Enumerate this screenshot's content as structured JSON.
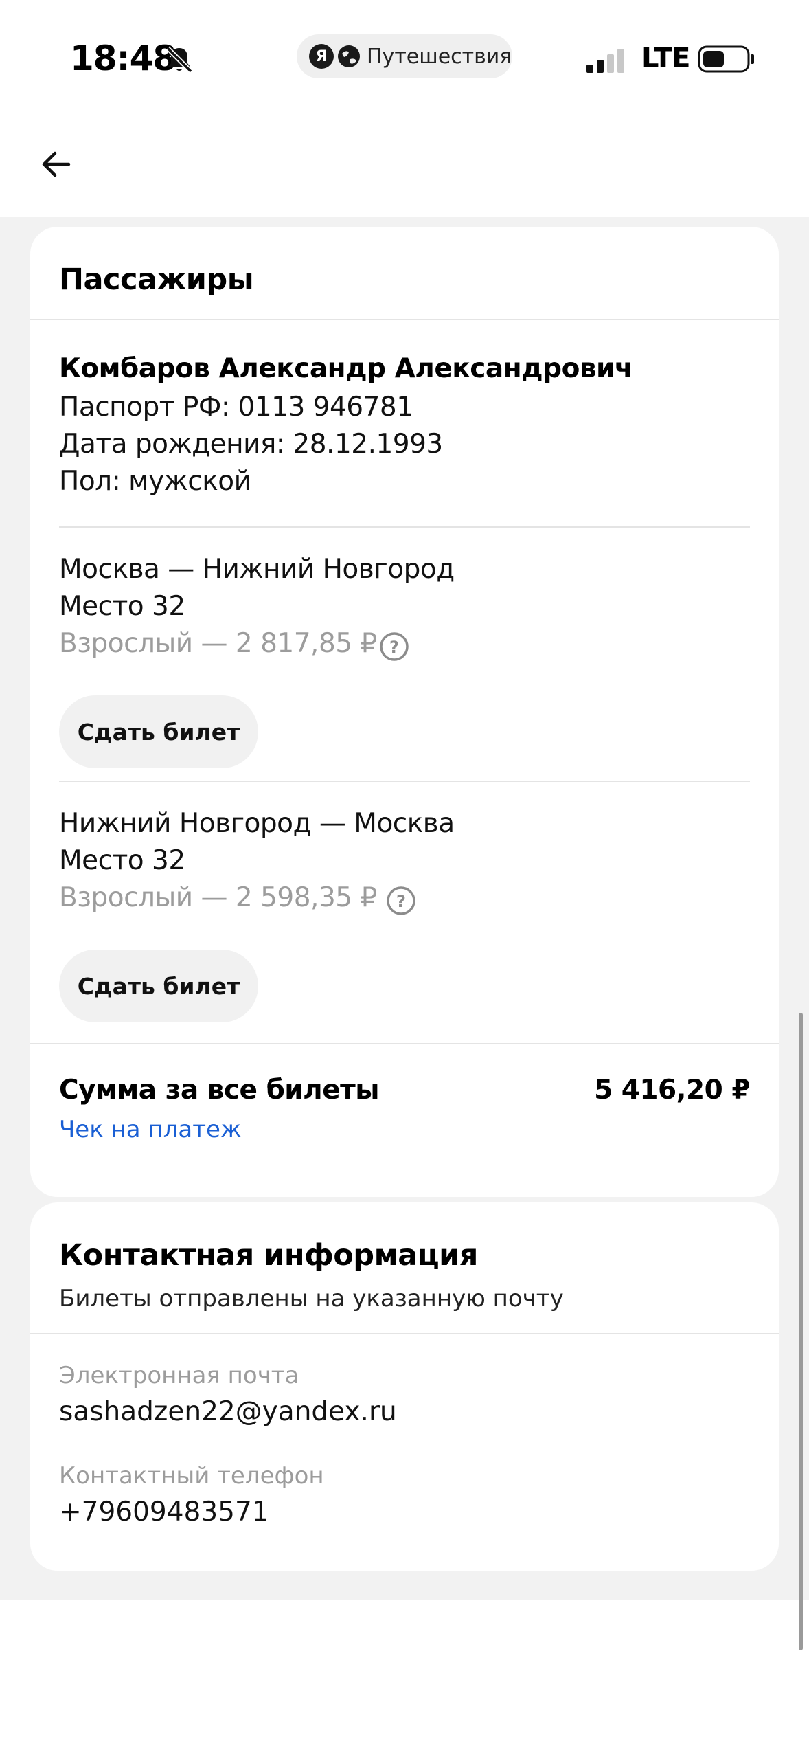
{
  "status_bar": {
    "time": "18:48",
    "app_badge": "Я",
    "app_name": "Путешествия",
    "network": "LTE"
  },
  "passengers": {
    "title": "Пассажиры",
    "passenger": {
      "name": "Комбаров Александр Александрович",
      "passport": "Паспорт РФ: 0113 946781",
      "birth_date": "Дата рождения: 28.12.1993",
      "gender": "Пол: мужской"
    },
    "tickets": [
      {
        "route": "Москва — Нижний Новгород",
        "seat": "Место 32",
        "fare": "Взрослый — 2 817,85 ₽",
        "refund_label": "Сдать билет"
      },
      {
        "route": "Нижний Новгород — Москва",
        "seat": "Место 32",
        "fare": "Взрослый — 2 598,35 ₽",
        "refund_label": "Сдать билет"
      }
    ],
    "total": {
      "label": "Сумма за все билеты",
      "value": "5 416,20 ₽",
      "receipt_link": "Чек на платеж"
    }
  },
  "contacts": {
    "title": "Контактная информация",
    "subtitle": "Билеты отправлены на указанную почту",
    "email_label": "Электронная почта",
    "email": "sashadzen22@yandex.ru",
    "phone_label": "Контактный телефон",
    "phone": "+79609483571"
  },
  "icons": {
    "back": "arrow-left-icon",
    "help": "question-circle-icon",
    "bell": "bell-slash-icon",
    "signal": "signal-bars-icon",
    "battery": "battery-icon",
    "globe": "globe-icon"
  },
  "colors": {
    "link": "#1a5fd4",
    "muted_text": "#9c9c9c",
    "page_background": "#f2f2f2",
    "button_background": "#f1f1f1"
  }
}
